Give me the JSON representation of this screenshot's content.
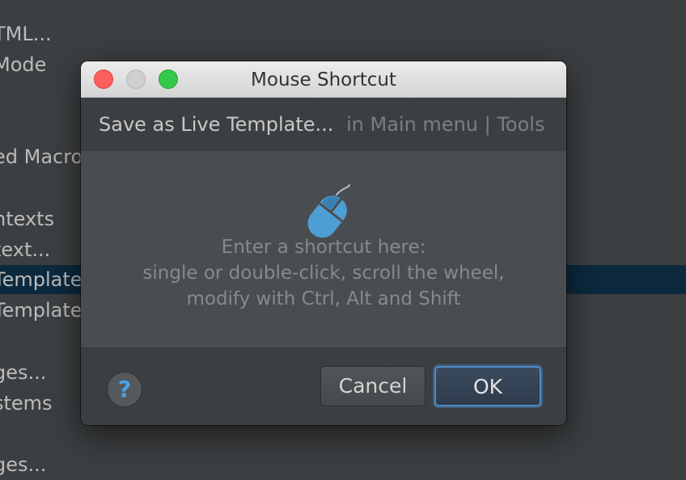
{
  "background_menu": {
    "items": [
      {
        "label": "TML..."
      },
      {
        "label": "Mode"
      },
      {
        "label": "ed Macros"
      },
      {
        "label": "ntexts"
      },
      {
        "label": "text..."
      },
      {
        "label": " Templates",
        "selected": true
      },
      {
        "label": "Templates"
      },
      {
        "label": "ges..."
      },
      {
        "label": "stems"
      },
      {
        "label": "ges..."
      }
    ]
  },
  "dialog": {
    "title": "Mouse Shortcut",
    "action_name": "Save as Live Template...",
    "action_location": "in Main menu | Tools",
    "hint_lines": [
      "Enter a shortcut here:",
      "single or double-click, scroll the wheel,",
      "modify with Ctrl, Alt and Shift"
    ],
    "help_label": "?",
    "cancel_label": "Cancel",
    "ok_label": "OK",
    "icons": {
      "mouse": "mouse-icon",
      "help": "help-icon"
    }
  },
  "colors": {
    "background": "#3c3f41",
    "selection": "#0d293e",
    "capture_area": "#4a4d50",
    "accent": "#4aa3ea"
  }
}
